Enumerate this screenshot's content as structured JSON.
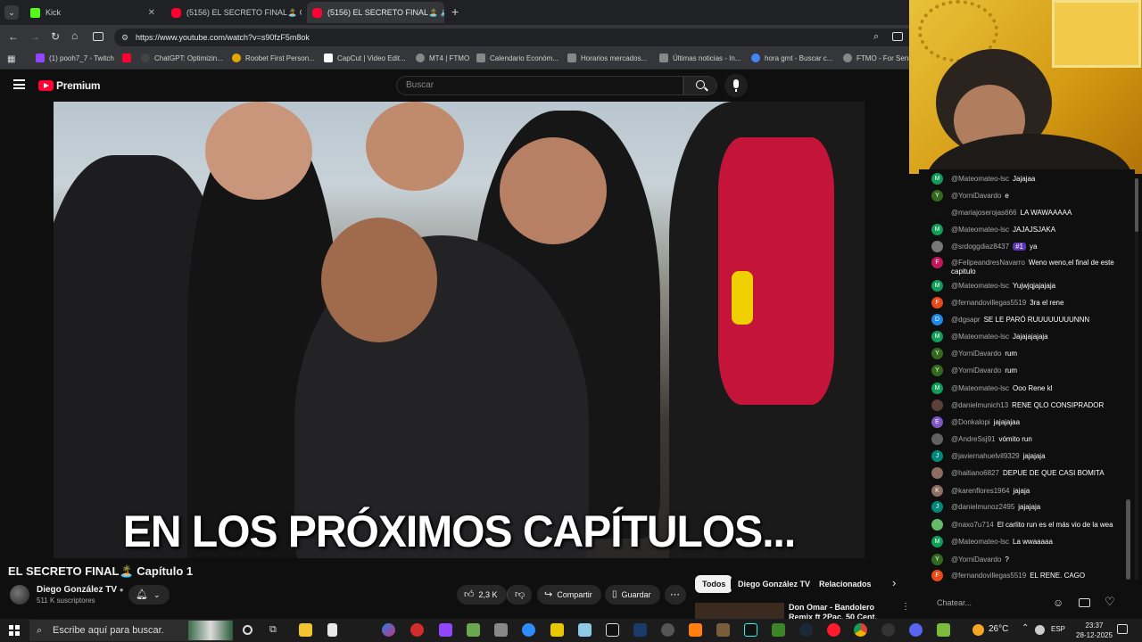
{
  "browser": {
    "tabs": [
      {
        "label": "Kick",
        "color": "#53fc18"
      },
      {
        "label": "(5156) EL SECRETO FINAL🏝️ C",
        "color": "#ff0033"
      },
      {
        "label": "(5156) EL SECRETO FINAL🏝️ 🔊",
        "color": "#ff0033"
      }
    ],
    "new_tab": "+",
    "url": "https://www.youtube.com/watch?v=s90fzF5m8ok",
    "bookmarks": [
      {
        "label": "(1) pooh7_7 - Twitch",
        "color": "#9146ff"
      },
      {
        "label": "",
        "color": "#ff0033"
      },
      {
        "label": "ChatGPT: Optimizin...",
        "color": "#444444"
      },
      {
        "label": "Roobet First Person...",
        "color": "#e0a800"
      },
      {
        "label": "CapCut | Video Edit...",
        "color": "#ffffff"
      },
      {
        "label": "MT4 | FTMO",
        "color": "#888888"
      },
      {
        "label": "Calendario Económ...",
        "color": "#888888"
      },
      {
        "label": "Horarios mercados...",
        "color": "#888888"
      },
      {
        "label": "Últimas noticias - In...",
        "color": "#888888"
      },
      {
        "label": "hora gmt - Buscar c...",
        "color": "#4285f4"
      },
      {
        "label": "FTMO - For Senio",
        "color": "#888888"
      }
    ]
  },
  "youtube": {
    "logo": "Premium",
    "search_placeholder": "Buscar",
    "subtitle": "EN LOS PRÓXIMOS CAPÍTULOS...",
    "video_title": "EL SECRETO FINAL🏝️ Capítulo 1",
    "channel": "Diego González TV",
    "subscribers": "511 K suscriptores",
    "likes": "2,3 K",
    "share": "Compartir",
    "save": "Guardar",
    "chips": [
      "Todos",
      "Diego González TV",
      "Relacionados"
    ],
    "rec_title": "Don Omar - Bandolero Remix ft 2Pac, 50 Cent, Eminem, The"
  },
  "chat": {
    "messages": [
      {
        "author": "@Mateomateo-lsc",
        "text": "Jajajaa",
        "initial": "M",
        "color": "#0f9d58"
      },
      {
        "author": "@YorniDavardo",
        "text": "e",
        "initial": "Y",
        "color": "#33691e"
      },
      {
        "author": "@mariajoserojas666",
        "text": "LA WAWAAAAA",
        "initial": "",
        "color": "#111111"
      },
      {
        "author": "@Mateomateo-lsc",
        "text": "JAJAJSJAKA",
        "initial": "M",
        "color": "#0f9d58"
      },
      {
        "author": "@srdoggdiaz8437",
        "text": "ya",
        "initial": "",
        "color": "#777777",
        "badge": "#1"
      },
      {
        "author": "@FelipeandresNavarro",
        "text": "Weno weno,el final de este capitulo",
        "initial": "F",
        "color": "#c2185b"
      },
      {
        "author": "@Mateomateo-lsc",
        "text": "Yujwjqjajajaja",
        "initial": "M",
        "color": "#0f9d58"
      },
      {
        "author": "@fernandovillegas5519",
        "text": "3ra el rene",
        "initial": "F",
        "color": "#e64a19"
      },
      {
        "author": "@dgsapr",
        "text": "SE LE PARÓ RUUUUUUUUNNN",
        "initial": "D",
        "color": "#1e88e5"
      },
      {
        "author": "@Mateomateo-lsc",
        "text": "Jajajajajaja",
        "initial": "M",
        "color": "#0f9d58"
      },
      {
        "author": "@YorniDavardo",
        "text": "rum",
        "initial": "Y",
        "color": "#33691e"
      },
      {
        "author": "@YorniDavardo",
        "text": "rum",
        "initial": "Y",
        "color": "#33691e"
      },
      {
        "author": "@Mateomateo-lsc",
        "text": "Ooo Rene kl",
        "initial": "M",
        "color": "#0f9d58"
      },
      {
        "author": "@danielmunich13",
        "text": "RENE QLO CONSIPRADOR",
        "initial": "",
        "color": "#5d4037"
      },
      {
        "author": "@Donkalopi",
        "text": "jajajajaa",
        "initial": "E",
        "color": "#7e57c2"
      },
      {
        "author": "@AndreSsj91",
        "text": "vómito run",
        "initial": "",
        "color": "#616161"
      },
      {
        "author": "@javiernahuelvil9329",
        "text": "jajajaja",
        "initial": "J",
        "color": "#00897b"
      },
      {
        "author": "@haitiano6827",
        "text": "DEPUE DE QUE CASI BOMITA",
        "initial": "",
        "color": "#8d6e63"
      },
      {
        "author": "@karenflores1964",
        "text": "jajaja",
        "initial": "K",
        "color": "#8d6e63"
      },
      {
        "author": "@danielmunoz2495",
        "text": "jajajaja",
        "initial": "J",
        "color": "#00897b"
      },
      {
        "author": "@naxo7u714",
        "text": "El carlito run es el más vio de la wea",
        "initial": "",
        "color": "#66bb6a"
      },
      {
        "author": "@Mateomateo-lsc",
        "text": "La wwaaaaa",
        "initial": "M",
        "color": "#0f9d58"
      },
      {
        "author": "@YorniDavardo",
        "text": "?",
        "initial": "Y",
        "color": "#33691e"
      },
      {
        "author": "@fernandovillegas5519",
        "text": "EL RENE. CAGO",
        "initial": "F",
        "color": "#e64a19"
      }
    ],
    "input_placeholder": "Chatear..."
  },
  "taskbar": {
    "search_placeholder": "Escribe aquí para buscar.",
    "weather": "26°C",
    "lang": "ESP",
    "time": "23:37",
    "date": "28-12-2025"
  }
}
